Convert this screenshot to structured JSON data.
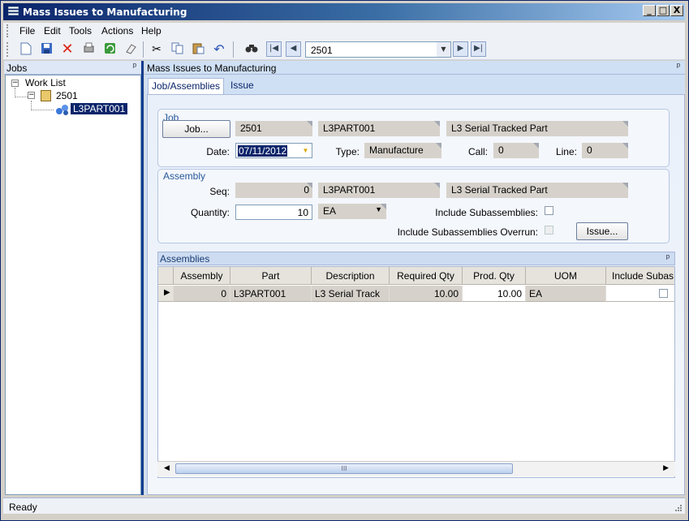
{
  "window": {
    "title": "Mass Issues to Manufacturing",
    "min": "_",
    "max": "□",
    "close": "X"
  },
  "menu": [
    "File",
    "Edit",
    "Tools",
    "Actions",
    "Help"
  ],
  "toolbar": {
    "nav_value": "2501",
    "icons": [
      "new-icon",
      "save-icon",
      "delete-icon",
      "print-icon",
      "refresh-icon",
      "clear-icon",
      "cut-icon",
      "copy-icon",
      "paste-icon",
      "undo-icon",
      "search-icon",
      "first-icon",
      "prev-icon",
      "next-icon",
      "last-icon"
    ]
  },
  "jobs_pane": {
    "title": "Jobs",
    "pin": "ᵖ",
    "tree": {
      "root": "Work List",
      "job": "2501",
      "assembly": "L3PART001"
    }
  },
  "main_pane": {
    "title": "Mass Issues to Manufacturing",
    "pin": "ᵖ"
  },
  "tabs": [
    "Job/Assemblies",
    "Issue"
  ],
  "job": {
    "group_label": "Job",
    "job_button": "Job...",
    "job_num": "2501",
    "part": "L3PART001",
    "description": "L3 Serial Tracked Part",
    "date_label": "Date:",
    "date_value": "07/11/2012",
    "type_label": "Type:",
    "type_value": "Manufacture",
    "call_label": "Call:",
    "call_value": "0",
    "line_label": "Line:",
    "line_value": "0"
  },
  "assembly": {
    "group_label": "Assembly",
    "seq_label": "Seq:",
    "seq_value": "0",
    "part": "L3PART001",
    "description": "L3 Serial Tracked Part",
    "qty_label": "Quantity:",
    "qty_value": "10",
    "uom": "EA",
    "include_sub_label": "Include Subassemblies:",
    "include_sub_overrun_label": "Include Subassemblies Overrun:",
    "issue_button": "Issue..."
  },
  "assemblies_grid": {
    "title": "Assemblies",
    "pin": "ᵖ",
    "columns": [
      "Assembly",
      "Part",
      "Description",
      "Required Qty",
      "Prod. Qty",
      "UOM",
      "Include Subas"
    ],
    "rows": [
      {
        "assembly": "0",
        "part": "L3PART001",
        "description": "L3 Serial Track",
        "required_qty": "10.00",
        "prod_qty": "10.00",
        "uom": "EA",
        "include_sub": false
      }
    ],
    "scroll_grip": "III"
  },
  "status": {
    "text": "Ready"
  }
}
